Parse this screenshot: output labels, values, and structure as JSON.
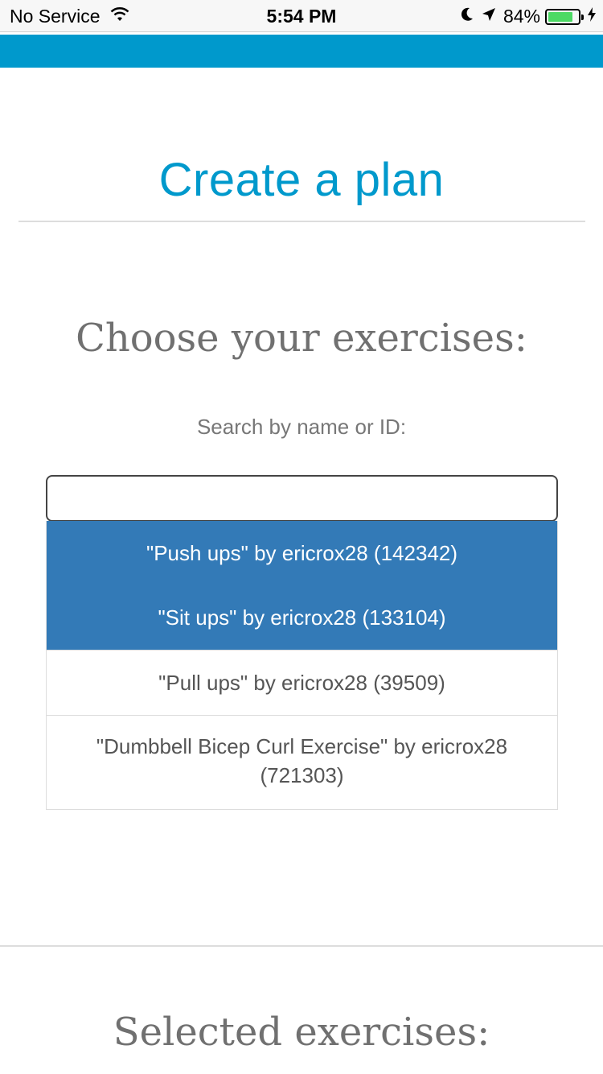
{
  "status_bar": {
    "carrier": "No Service",
    "time": "5:54 PM",
    "battery_percent": "84%",
    "battery_level": 0.84,
    "battery_color": "#4cd964",
    "icons": [
      "wifi-icon",
      "moon-icon",
      "location-arrow-icon",
      "battery-icon",
      "charging-bolt-icon"
    ]
  },
  "header": {
    "bar_color": "#0099cc"
  },
  "page": {
    "title": "Create a plan",
    "title_color": "#0099cc"
  },
  "exercises": {
    "heading": "Choose your exercises:",
    "search_label": "Search by name or ID:",
    "search_value": "",
    "search_placeholder": "",
    "active_color": "#337ab7",
    "results": [
      {
        "label": "\"Push ups\" by ericrox28 (142342)",
        "active": true
      },
      {
        "label": "\"Sit ups\" by ericrox28 (133104)",
        "active": true
      },
      {
        "label": "\"Pull ups\" by ericrox28 (39509)",
        "active": false
      },
      {
        "label": "\"Dumbbell Bicep Curl Exercise\" by ericrox28 (721303)",
        "active": false
      }
    ]
  },
  "selected": {
    "heading": "Selected exercises:"
  }
}
